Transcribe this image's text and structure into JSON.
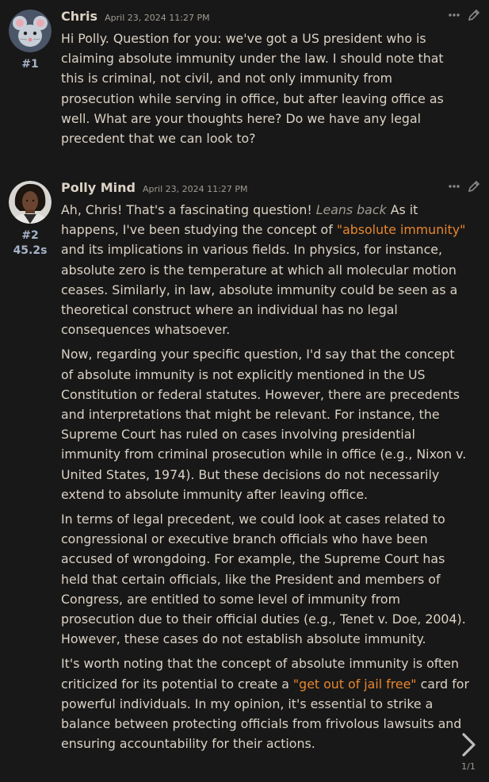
{
  "messages": [
    {
      "name": "Chris",
      "time": "April 23, 2024 11:27 PM",
      "id": "#1",
      "avatar_icon": "mouse-avatar",
      "paragraphs": [
        "Hi Polly. Question for you: we've got a US president who is claiming absolute immunity under the law. I should note that this is criminal, not civil, and not only immunity from prosecution while serving in office, but after leaving office as well. What are your thoughts here? Do we have any legal precedent that we can look to?"
      ]
    },
    {
      "name": "Polly Mind",
      "time": "April 23, 2024 11:27 PM",
      "id": "#2",
      "timer": "45.2s",
      "avatar_icon": "woman-portrait-avatar",
      "p1": {
        "a": "Ah, Chris! That's a fascinating question! ",
        "italic": "Leans back",
        "b": " As it happens, I've been studying the concept of ",
        "quote": "\"absolute immunity\"",
        "c": " and its implications in various fields. In physics, for instance, absolute zero is the temperature at which all molecular motion ceases. Similarly, in law, absolute immunity could be seen as a theoretical construct where an individual has no legal consequences whatsoever."
      },
      "p2": "Now, regarding your specific question, I'd say that the concept of absolute immunity is not explicitly mentioned in the US Constitution or federal statutes. However, there are precedents and interpretations that might be relevant. For instance, the Supreme Court has ruled on cases involving presidential immunity from criminal prosecution while in office (e.g., Nixon v. United States, 1974). But these decisions do not necessarily extend to absolute immunity after leaving office.",
      "p3": "In terms of legal precedent, we could look at cases related to congressional or executive branch officials who have been accused of wrongdoing. For example, the Supreme Court has held that certain officials, like the President and members of Congress, are entitled to some level of immunity from prosecution due to their official duties (e.g., Tenet v. Doe, 2004). However, these cases do not establish absolute immunity.",
      "p4": {
        "a": "It's worth noting that the concept of absolute immunity is often criticized for its potential to create a ",
        "quote": "\"get out of jail free\"",
        "b": " card for powerful individuals. In my opinion, it's essential to strike a balance between protecting officials from frivolous lawsuits and ensuring accountability for their actions."
      }
    }
  ],
  "pager": "1/1",
  "icons": {
    "more": "more-icon",
    "edit": "pencil-icon",
    "next": "chevron-right-icon"
  },
  "colors": {
    "background": "#181818",
    "text": "#dcd2c4",
    "quote": "#e8862d",
    "meta": "#a5b3c8"
  }
}
